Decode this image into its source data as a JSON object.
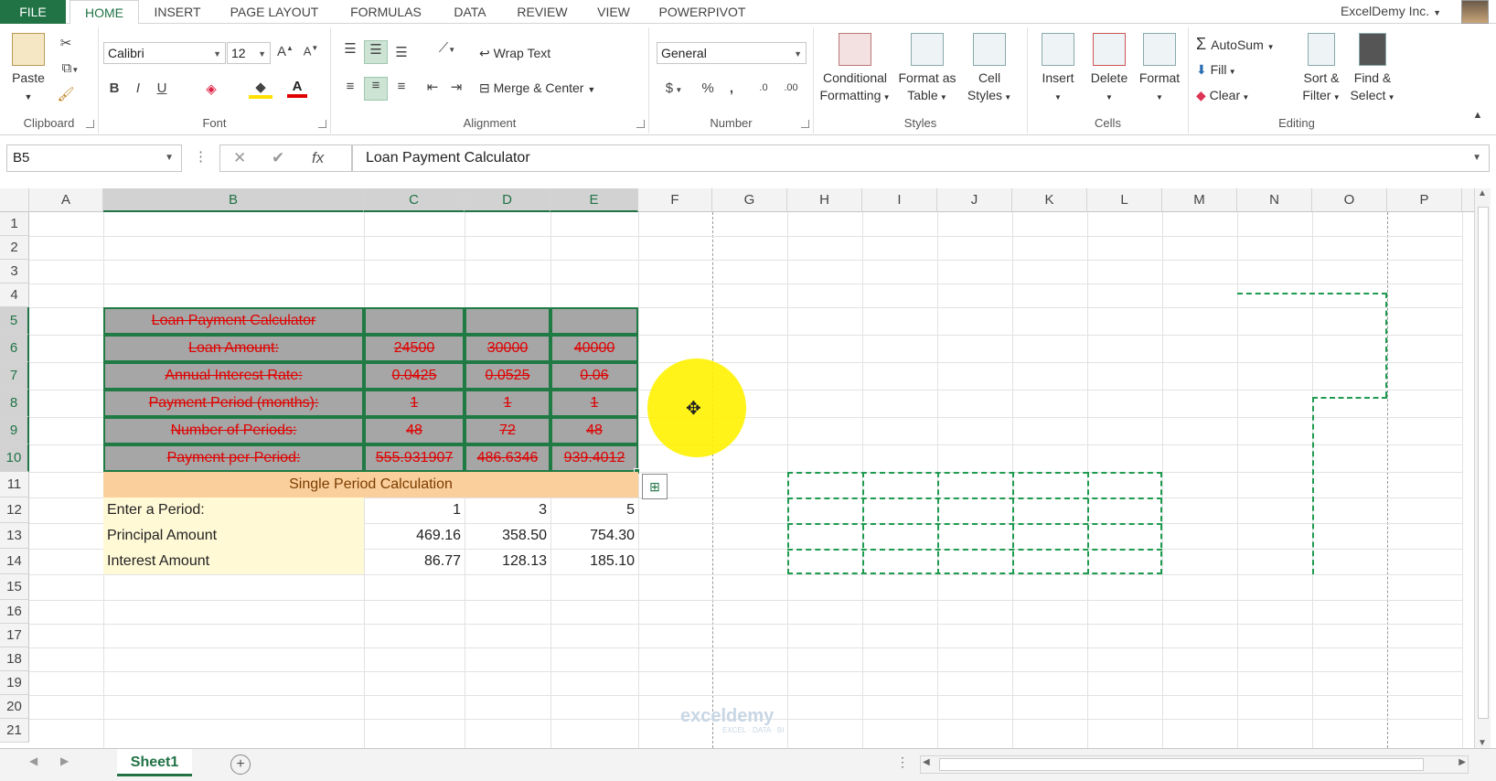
{
  "tabs": {
    "file": "FILE",
    "home": "HOME",
    "insert": "INSERT",
    "page_layout": "PAGE LAYOUT",
    "formulas": "FORMULAS",
    "data": "DATA",
    "review": "REVIEW",
    "view": "VIEW",
    "powerpivot": "POWERPIVOT"
  },
  "account": "ExcelDemy Inc.",
  "ribbon": {
    "clipboard": {
      "label": "Clipboard",
      "paste": "Paste"
    },
    "font": {
      "label": "Font",
      "name": "Calibri",
      "size": "12",
      "bold": "B",
      "italic": "I",
      "underline": "U"
    },
    "alignment": {
      "label": "Alignment",
      "wrap_text": "Wrap Text",
      "merge_center": "Merge & Center"
    },
    "number": {
      "label": "Number",
      "format": "General",
      "currency": "$",
      "percent": "%",
      "comma": ",",
      "inc_dec": ".00",
      "dec_dec": ".0"
    },
    "styles": {
      "label": "Styles",
      "conditional_1": "Conditional",
      "conditional_2": "Formatting",
      "format_table_1": "Format as",
      "format_table_2": "Table",
      "cell_styles_1": "Cell",
      "cell_styles_2": "Styles"
    },
    "cells": {
      "label": "Cells",
      "insert": "Insert",
      "delete": "Delete",
      "format": "Format"
    },
    "editing": {
      "label": "Editing",
      "autosum": "AutoSum",
      "fill": "Fill",
      "clear": "Clear",
      "sort_1": "Sort &",
      "sort_2": "Filter",
      "find_1": "Find &",
      "find_2": "Select"
    }
  },
  "formula_bar": {
    "name_box": "B5",
    "fx": "fx",
    "content": "Loan Payment Calculator"
  },
  "columns": [
    "A",
    "B",
    "C",
    "D",
    "E",
    "F",
    "G",
    "H",
    "I",
    "J",
    "K",
    "L",
    "M",
    "N",
    "O",
    "P"
  ],
  "rows": [
    "1",
    "2",
    "3",
    "4",
    "5",
    "6",
    "7",
    "8",
    "9",
    "10",
    "11",
    "12",
    "13",
    "14",
    "15",
    "16",
    "17",
    "18",
    "19",
    "20",
    "21"
  ],
  "loan_table": {
    "title": "Loan Payment Calculator",
    "rows": [
      {
        "label": "Loan Amount:",
        "c": "24500",
        "d": "30000",
        "e": "40000"
      },
      {
        "label": "Annual Interest Rate:",
        "c": "0.0425",
        "d": "0.0525",
        "e": "0.06"
      },
      {
        "label": "Payment Period (months):",
        "c": "1",
        "d": "1",
        "e": "1"
      },
      {
        "label": "Number of Periods:",
        "c": "48",
        "d": "72",
        "e": "48"
      },
      {
        "label": "Payment per Period:",
        "c": "555.931907",
        "d": "486.6346",
        "e": "939.4012"
      }
    ]
  },
  "single_period": {
    "title": "Single Period Calculation",
    "rows": [
      {
        "label": "Enter a Period:",
        "c": "1",
        "d": "3",
        "e": "5"
      },
      {
        "label": "Principal Amount",
        "c": "469.16",
        "d": "358.50",
        "e": "754.30"
      },
      {
        "label": "Interest Amount",
        "c": "86.77",
        "d": "128.13",
        "e": "185.10"
      }
    ]
  },
  "sheet_tab": "Sheet1",
  "watermark": "exceldemy",
  "watermark_sub": "EXCEL · DATA · BI"
}
